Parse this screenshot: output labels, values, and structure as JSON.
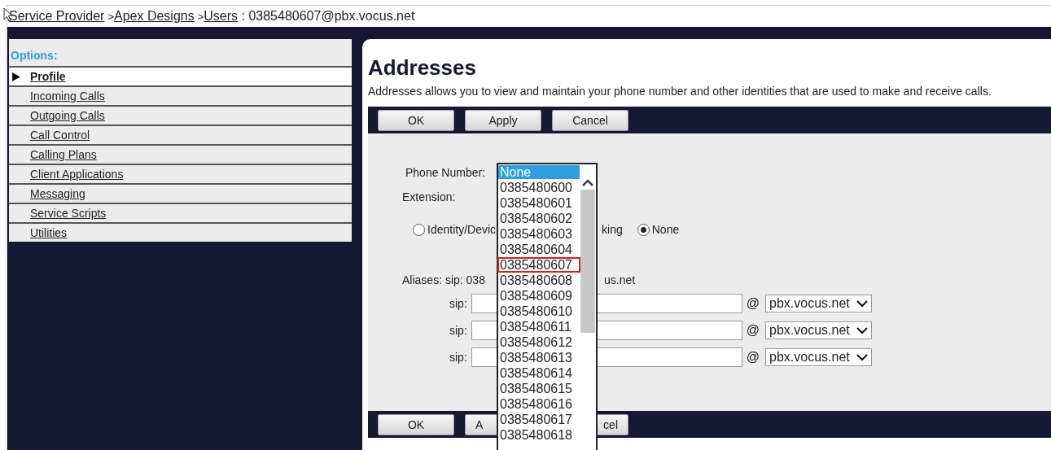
{
  "breadcrumb": {
    "links": [
      "Service Provider",
      "Apex Designs",
      "Users"
    ],
    "separator": ">",
    "current": ": 0385480607@pbx.vocus.net"
  },
  "sidebar": {
    "title": "Options:",
    "items": [
      {
        "label": "Profile",
        "selected": true
      },
      {
        "label": "Incoming Calls",
        "selected": false
      },
      {
        "label": "Outgoing Calls",
        "selected": false
      },
      {
        "label": "Call Control",
        "selected": false
      },
      {
        "label": "Calling Plans",
        "selected": false
      },
      {
        "label": "Client Applications",
        "selected": false
      },
      {
        "label": "Messaging",
        "selected": false
      },
      {
        "label": "Service Scripts",
        "selected": false
      },
      {
        "label": "Utilities",
        "selected": false
      }
    ]
  },
  "page": {
    "title": "Addresses",
    "description": "Addresses allows you to view and maintain your phone number and other identities that are used to make and receive calls."
  },
  "top_buttons": [
    "OK",
    "Apply",
    "Cancel"
  ],
  "form": {
    "phone_number_label": "Phone Number:",
    "extension_label": "Extension:",
    "radio_row": [
      {
        "kind": "radio",
        "label": "Identity/Devic",
        "selected": false
      },
      {
        "kind": "fragment",
        "label": "king"
      },
      {
        "kind": "radio",
        "label": "None",
        "selected": true
      }
    ],
    "aliases_label": "Aliases: sip: 038",
    "aliases_tail": "us.net",
    "alias_rows": [
      {
        "label": "sip:",
        "at": "@",
        "domain": "pbx.vocus.net"
      },
      {
        "label": "sip:",
        "at": "@",
        "domain": "pbx.vocus.net"
      },
      {
        "label": "sip:",
        "at": "@",
        "domain": "pbx.vocus.net"
      }
    ]
  },
  "bottom_buttons": [
    "OK",
    "A",
    "cel"
  ],
  "phone_number_list": [
    {
      "label": "None",
      "selected": true,
      "focused": false
    },
    {
      "label": "0385480600",
      "selected": false,
      "focused": false
    },
    {
      "label": "0385480601",
      "selected": false,
      "focused": false
    },
    {
      "label": "0385480602",
      "selected": false,
      "focused": false
    },
    {
      "label": "0385480603",
      "selected": false,
      "focused": false
    },
    {
      "label": "0385480604",
      "selected": false,
      "focused": false
    },
    {
      "label": "0385480607",
      "selected": false,
      "focused": true
    },
    {
      "label": "0385480608",
      "selected": false,
      "focused": false
    },
    {
      "label": "0385480609",
      "selected": false,
      "focused": false
    },
    {
      "label": "0385480610",
      "selected": false,
      "focused": false
    },
    {
      "label": "0385480611",
      "selected": false,
      "focused": false
    },
    {
      "label": "0385480612",
      "selected": false,
      "focused": false
    },
    {
      "label": "0385480613",
      "selected": false,
      "focused": false
    },
    {
      "label": "0385480614",
      "selected": false,
      "focused": false
    },
    {
      "label": "0385480615",
      "selected": false,
      "focused": false
    },
    {
      "label": "0385480616",
      "selected": false,
      "focused": false
    },
    {
      "label": "0385480617",
      "selected": false,
      "focused": false
    },
    {
      "label": "0385480618",
      "selected": false,
      "focused": false
    }
  ]
}
